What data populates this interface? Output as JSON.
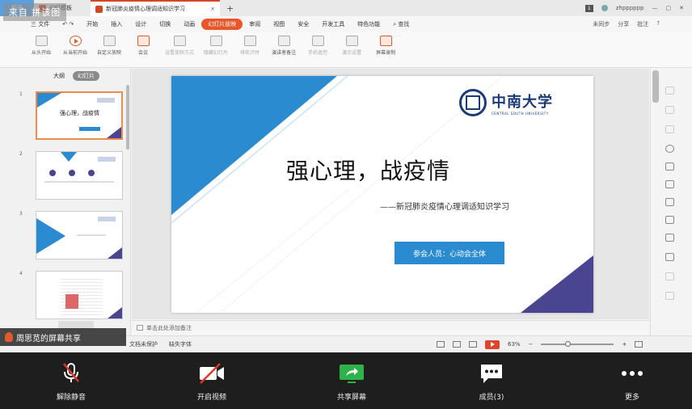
{
  "watermark": "来自 拼该图",
  "titlebar": {
    "tabs": [
      "稻壳",
      "幻灯模板",
      "新冠肺炎疫情心理调适知识学习"
    ],
    "count": "1",
    "user": "zhpppppp"
  },
  "menu": {
    "file": "三 文件",
    "items": [
      "开始",
      "插入",
      "设计",
      "切换",
      "动画",
      "幻灯片放映",
      "审阅",
      "视图",
      "安全",
      "开发工具",
      "特色功能"
    ],
    "active_index": 5,
    "search": "查找",
    "right": [
      "未同步",
      "分享",
      "批注"
    ]
  },
  "ribbon": {
    "buttons": [
      "从头开始",
      "从当前开始",
      "自定义放映",
      "会议",
      "设置放映方式",
      "隐藏幻灯片",
      "排练计时",
      "演讲者备注",
      "手机遥控",
      "演示设置",
      "屏幕录制"
    ]
  },
  "leftpanel": {
    "tabs": [
      "大纲",
      "幻灯片"
    ],
    "thumb_numbers": [
      "1",
      "2",
      "3",
      "4"
    ],
    "thumb1_title": "强心理，战疫情"
  },
  "slide": {
    "title": "强心理，战疫情",
    "subtitle": "——新冠肺炎疫情心理调适知识学习",
    "button": "参会人员：心动会全体",
    "logo_cn": "中南大学",
    "logo_en": "CENTRAL SOUTH UNIVERSITY",
    "colors": {
      "blue": "#2a8bd0",
      "purple": "#4a4590"
    }
  },
  "notes": {
    "placeholder": "单击此处添加备注"
  },
  "statusbar": {
    "left": [
      "文档未保护",
      "缺失字体"
    ],
    "zoom": "63%"
  },
  "share_banner": "周思苋的屏幕共享",
  "meeting": {
    "buttons": [
      {
        "label": "解除静音",
        "icon": "mic-muted-icon"
      },
      {
        "label": "开启视频",
        "icon": "camera-off-icon"
      },
      {
        "label": "共享屏幕",
        "icon": "share-screen-icon"
      },
      {
        "label": "成员(3)",
        "icon": "members-icon"
      },
      {
        "label": "更多",
        "icon": "more-icon"
      }
    ]
  }
}
